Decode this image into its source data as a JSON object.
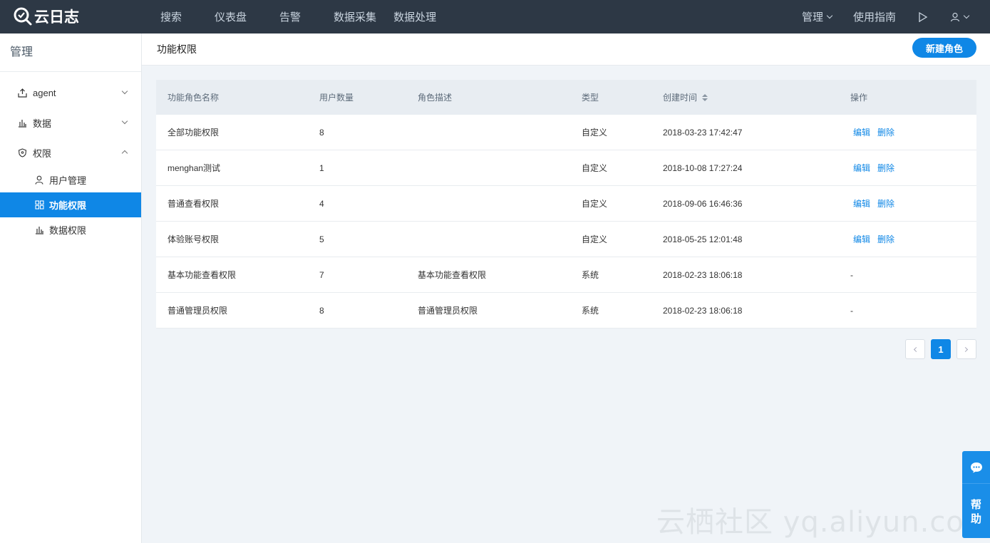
{
  "app": {
    "logo_text": "云日志"
  },
  "topnav": {
    "items": [
      "搜索",
      "仪表盘",
      "告警",
      "数据采集",
      "数据处理"
    ],
    "manage_label": "管理",
    "guide_label": "使用指南"
  },
  "sidebar": {
    "title": "管理",
    "groups": [
      {
        "label": "agent",
        "icon": "upload-icon",
        "expanded": false
      },
      {
        "label": "数据",
        "icon": "bar-chart-icon",
        "expanded": false
      },
      {
        "label": "权限",
        "icon": "shield-icon",
        "expanded": true
      }
    ],
    "sub_items": [
      {
        "label": "用户管理",
        "icon": "user-icon",
        "active": false
      },
      {
        "label": "功能权限",
        "icon": "grid-icon",
        "active": true
      },
      {
        "label": "数据权限",
        "icon": "bar-chart-icon",
        "active": false
      }
    ]
  },
  "page": {
    "title": "功能权限",
    "new_button": "新建角色"
  },
  "table": {
    "columns": [
      "功能角色名称",
      "用户数量",
      "角色描述",
      "类型",
      "创建时间",
      "操作"
    ],
    "edit_label": "编辑",
    "delete_label": "删除",
    "rows": [
      {
        "name": "全部功能权限",
        "users": "8",
        "desc": "",
        "type": "自定义",
        "created": "2018-03-23 17:42:47",
        "actions": true
      },
      {
        "name": "menghan测试",
        "users": "1",
        "desc": "",
        "type": "自定义",
        "created": "2018-10-08 17:27:24",
        "actions": true
      },
      {
        "name": "普通查看权限",
        "users": "4",
        "desc": "",
        "type": "自定义",
        "created": "2018-09-06 16:46:36",
        "actions": true
      },
      {
        "name": "体验账号权限",
        "users": "5",
        "desc": "",
        "type": "自定义",
        "created": "2018-05-25 12:01:48",
        "actions": true
      },
      {
        "name": "基本功能查看权限",
        "users": "7",
        "desc": "基本功能查看权限",
        "type": "系统",
        "created": "2018-02-23 18:06:18",
        "actions": false,
        "action_text": "-"
      },
      {
        "name": "普通管理员权限",
        "users": "8",
        "desc": "普通管理员权限",
        "type": "系统",
        "created": "2018-02-23 18:06:18",
        "actions": false,
        "action_text": "-"
      }
    ]
  },
  "pagination": {
    "current": "1"
  },
  "help": {
    "label": "帮助"
  },
  "watermark": "云栖社区 yq.aliyun.com",
  "colors": {
    "topbar": "#2d3845",
    "accent": "#0f87e6",
    "background": "#f0f4f8"
  }
}
